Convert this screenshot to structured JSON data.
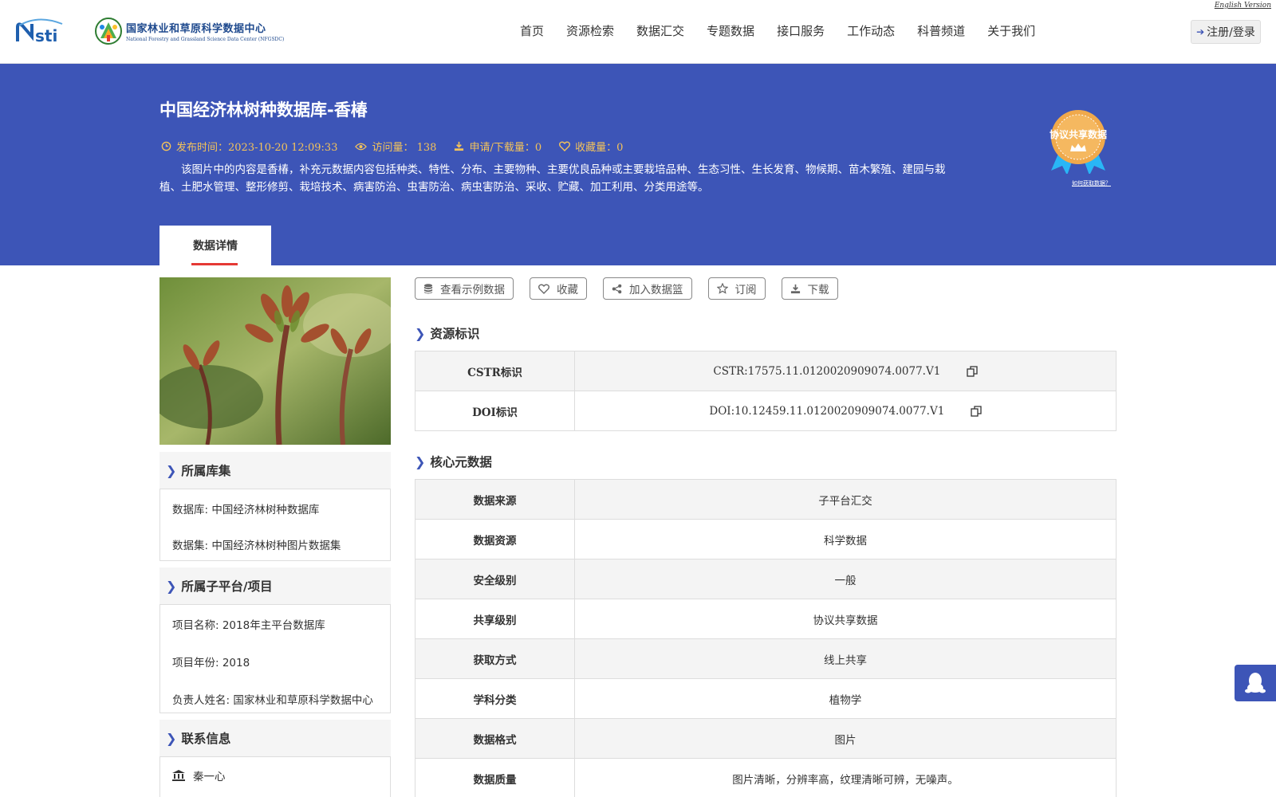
{
  "header": {
    "english_link": "English Version",
    "center_name_cn": "国家林业和草原科学数据中心",
    "center_name_en": "National Forestry and Grassland Science Data Center (NFGSDC)",
    "nav": [
      "首页",
      "资源检索",
      "数据汇交",
      "专题数据",
      "接口服务",
      "工作动态",
      "科普频道",
      "关于我们"
    ],
    "login_label": "注册/登录"
  },
  "banner": {
    "title": "中国经济林树种数据库-香椿",
    "publish_time": "发布时间：2023-10-20 12:09:33",
    "views": "访问量： 138",
    "downloads": "申请/下载量：0",
    "favorites": "收藏量：0",
    "description": "该图片中的内容是香椿，补充元数据内容包括种类、特性、分布、主要物种、主要优良品种或主要栽培品种、生态习性、生长发育、物候期、苗木繁殖、建园与栽植、土肥水管理、整形修剪、栽培技术、病害防治、虫害防治、病虫害防治、采收、贮藏、加工利用、分类用途等。",
    "badge_label": "协议共享数据",
    "badge_help": "如何获取数据？",
    "tab_label": "数据详情"
  },
  "left": {
    "collection_title": "所属库集",
    "database": "数据库: 中国经济林树种数据库",
    "dataset": "数据集: 中国经济林树种图片数据集",
    "project_title": "所属子平台/项目",
    "project_name": "项目名称: 2018年主平台数据库",
    "project_year": "项目年份: 2018",
    "project_lead": "负责人姓名: 国家林业和草原科学数据中心",
    "contact_title": "联系信息",
    "contact_name": "秦一心"
  },
  "actions": {
    "sample": "查看示例数据",
    "favorite": "收藏",
    "basket": "加入数据篮",
    "subscribe": "订阅",
    "download": "下载"
  },
  "identity": {
    "title": "资源标识",
    "rows": [
      {
        "key": "CSTR标识",
        "value": "CSTR:17575.11.0120020909074.0077.V1"
      },
      {
        "key": "DOI标识",
        "value": "DOI:10.12459.11.0120020909074.0077.V1"
      }
    ]
  },
  "core": {
    "title": "核心元数据",
    "rows": [
      {
        "key": "数据来源",
        "value": "子平台汇交"
      },
      {
        "key": "数据资源",
        "value": "科学数据"
      },
      {
        "key": "安全级别",
        "value": "一般"
      },
      {
        "key": "共享级别",
        "value": "协议共享数据"
      },
      {
        "key": "获取方式",
        "value": "线上共享"
      },
      {
        "key": "学科分类",
        "value": "植物学"
      },
      {
        "key": "数据格式",
        "value": "图片"
      },
      {
        "key": "数据质量",
        "value": "图片清晰，分辨率高，纹理清晰可辨，无噪声。"
      }
    ]
  },
  "colors": {
    "banner": "#3d55b7",
    "meta_text": "#f4c35a",
    "tab_underline": "#e53935"
  }
}
